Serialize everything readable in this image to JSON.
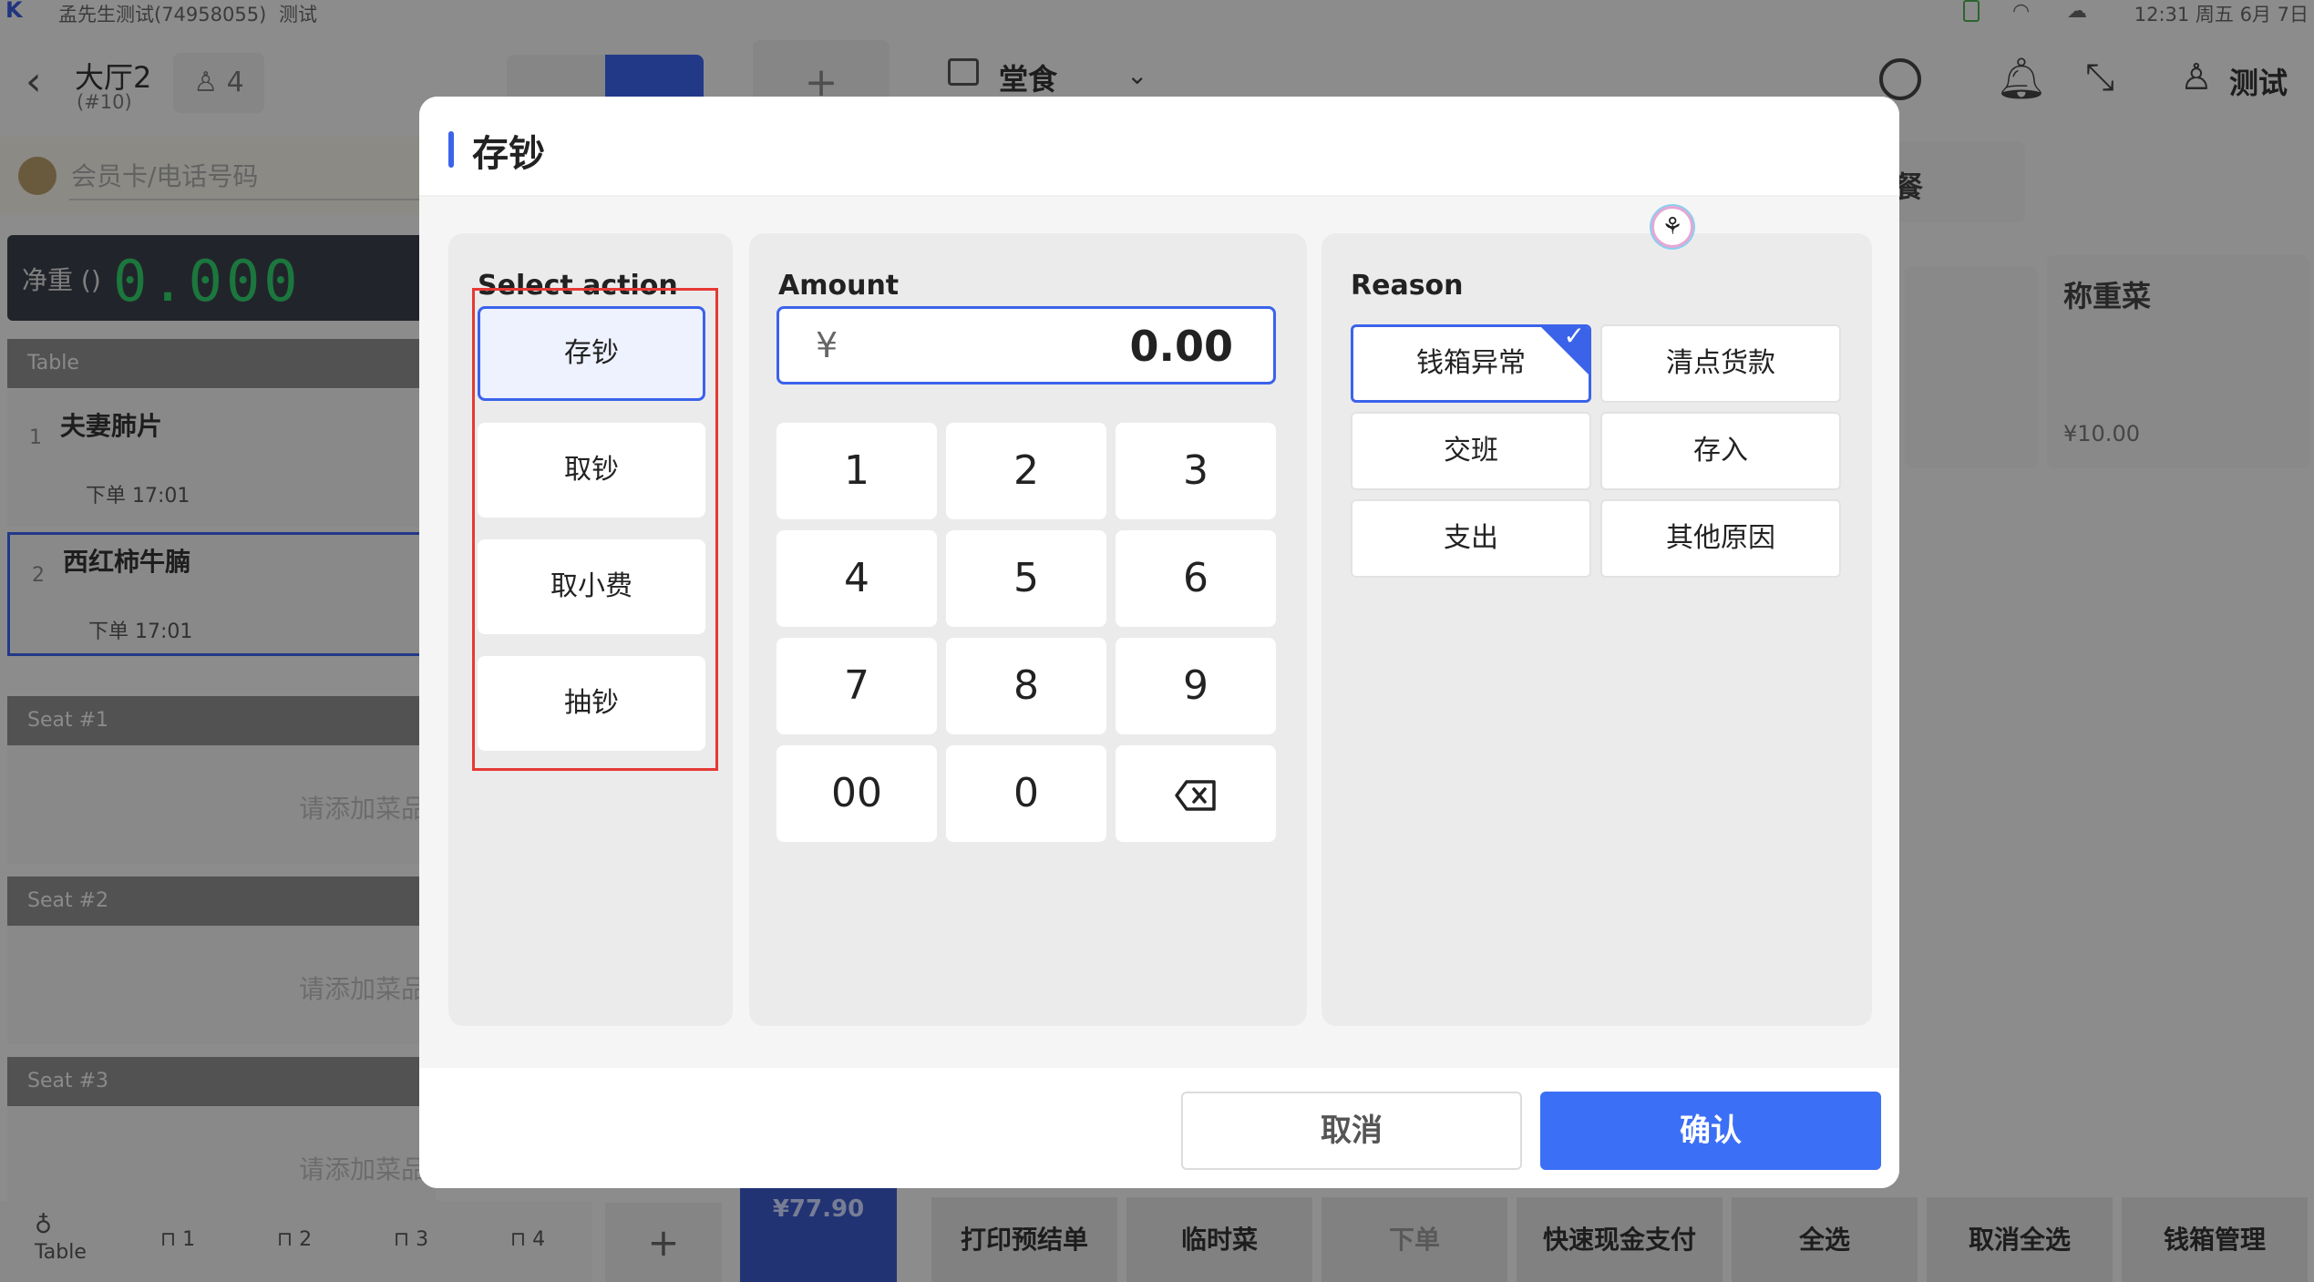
{
  "status_bar": {
    "account": "孟先生测试(74958055)",
    "mode": "测试",
    "time": "12:31 周五 6月 7日"
  },
  "header": {
    "table_name": "大厅2",
    "table_no": "(#10)",
    "guests": "4",
    "dining_mode": "堂食",
    "user_name": "测试"
  },
  "member": {
    "placeholder": "会员卡/电话号码"
  },
  "scale": {
    "label": "净重 ()",
    "value": "0.000"
  },
  "order": {
    "table_header": "Table",
    "items": [
      {
        "index": "1",
        "name": "夫妻肺片",
        "time": "下单 17:01"
      },
      {
        "index": "2",
        "name": "西红柿牛腩",
        "time": "下单 17:01"
      }
    ],
    "seats": [
      {
        "label": "Seat #1",
        "empty": "请添加菜品"
      },
      {
        "label": "Seat #2",
        "empty": "请添加菜品"
      },
      {
        "label": "Seat #3",
        "empty": "请添加菜品"
      }
    ]
  },
  "bottom_nav": {
    "table_label": "Table",
    "seats": [
      "1",
      "2",
      "3",
      "4"
    ],
    "plus": "+"
  },
  "right_panel": {
    "partial_tab": "餐",
    "dish_card": {
      "name": "称重菜",
      "price": "¥10.00"
    }
  },
  "bottom_actions": {
    "total": "¥77.90",
    "buttons": [
      "打印预结单",
      "临时菜",
      "下单",
      "快速现金支付",
      "全选",
      "取消全选",
      "钱箱管理"
    ]
  },
  "dialog": {
    "title": "存钞",
    "select_action_label": "Select action",
    "actions": [
      "存钞",
      "取钞",
      "取小费",
      "抽钞"
    ],
    "selected_action": "存钞",
    "amount_label": "Amount",
    "currency": "¥",
    "amount_value": "0.00",
    "keypad": [
      "1",
      "2",
      "3",
      "4",
      "5",
      "6",
      "7",
      "8",
      "9",
      "00",
      "0"
    ],
    "reason_label": "Reason",
    "reasons": [
      "钱箱异常",
      "清点货款",
      "交班",
      "存入",
      "支出",
      "其他原因"
    ],
    "selected_reason": "钱箱异常",
    "cancel_label": "取消",
    "confirm_label": "确认"
  },
  "colors": {
    "accent": "#3b63ea",
    "confirm": "#3b6ff5",
    "highlight_box": "#e53935",
    "scale_digits": "#2fce6a"
  }
}
